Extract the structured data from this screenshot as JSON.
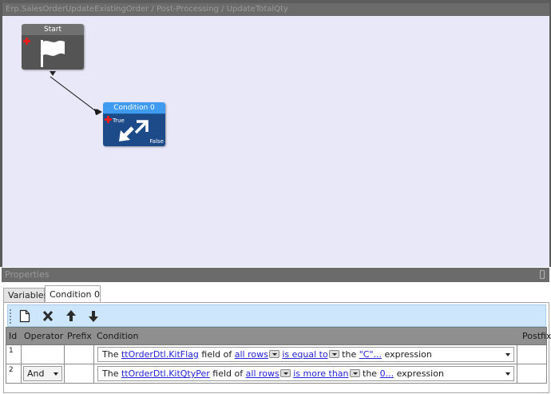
{
  "designer": {
    "breadcrumb": "Erp.SalesOrderUpdateExistingOrder / Post-Processing / UpdateTotalQty",
    "nodes": {
      "start": {
        "title": "Start",
        "icon": "flag-icon"
      },
      "condition": {
        "title": "Condition 0",
        "icon": "diagonal-arrows-icon",
        "true_label": "True",
        "false_label": "False"
      }
    }
  },
  "properties": {
    "title": "Properties",
    "tabs": [
      {
        "label": "Variables",
        "active": false
      },
      {
        "label": "Condition 0",
        "active": true
      }
    ],
    "toolbar": {
      "buttons": [
        {
          "icon": "new-document-icon"
        },
        {
          "icon": "delete-icon"
        },
        {
          "icon": "move-up-icon"
        },
        {
          "icon": "move-down-icon"
        }
      ]
    },
    "grid": {
      "columns": [
        "Id",
        "Operator",
        "Prefix",
        "Condition",
        "Postfix"
      ],
      "rows": [
        {
          "id": "1",
          "operator": "",
          "prefix": "",
          "condition": {
            "the": "The",
            "field": "ttOrderDtl.KitFlag",
            "field_of": "field of",
            "scope": "all rows",
            "comparison": "is equal to",
            "the2": "the",
            "value": "\"C\"...",
            "suffix": "expression"
          },
          "postfix": ""
        },
        {
          "id": "2",
          "operator": "And",
          "prefix": "",
          "condition": {
            "the": "The",
            "field": "ttOrderDtl.KitQtyPer",
            "field_of": "field of",
            "scope": "all rows",
            "comparison": "is more than",
            "the2": "the",
            "value": "0...",
            "suffix": "expression"
          },
          "postfix": ""
        }
      ]
    }
  },
  "colors": {
    "canvas_background": "#e9e8f8",
    "condition_node_header": "#3f9bf0",
    "condition_node_body": "#1d4b8a",
    "start_node_body": "#545454",
    "link_color": "#2323d9",
    "toolbar_background": "#cde6fb",
    "grid_header": "#8f8f8f"
  }
}
